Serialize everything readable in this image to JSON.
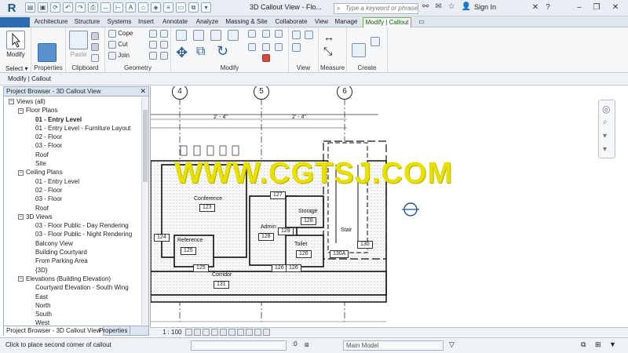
{
  "app": {
    "logo": "R",
    "window_title": "3D Callout View - Flo...",
    "search_placeholder": "Type a keyword or phrase",
    "sign_in": "Sign In"
  },
  "tabs": [
    "Architecture",
    "Structure",
    "Systems",
    "Insert",
    "Annotate",
    "Analyze",
    "Massing & Site",
    "Collaborate",
    "View",
    "Manage",
    "Modify | Callout"
  ],
  "ribbon": {
    "modify": "Modify",
    "select": "Select ▾",
    "properties": "Properties",
    "clipboard": "Clipboard",
    "paste": "Paste",
    "geometry": "Geometry",
    "cope": "Cope",
    "cut": "Cut",
    "join": "Join",
    "modify_panel": "Modify",
    "view": "View",
    "measure": "Measure",
    "create": "Create"
  },
  "options_bar": "Modify | Callout",
  "project_browser": {
    "title": "Project Browser - 3D Callout View",
    "items": [
      {
        "text": "Views (all)",
        "level": 0,
        "toggle": "−"
      },
      {
        "text": "Floor Plans",
        "level": 1,
        "toggle": "−"
      },
      {
        "text": "01 - Entry Level",
        "level": 2,
        "bold": true
      },
      {
        "text": "01 - Entry Level - Furniture Layout",
        "level": 2
      },
      {
        "text": "02 - Floor",
        "level": 2
      },
      {
        "text": "03 - Floor",
        "level": 2
      },
      {
        "text": "Roof",
        "level": 2
      },
      {
        "text": "Site",
        "level": 2
      },
      {
        "text": "Ceiling Plans",
        "level": 1,
        "toggle": "−"
      },
      {
        "text": "01 - Entry Level",
        "level": 2
      },
      {
        "text": "02 - Floor",
        "level": 2
      },
      {
        "text": "03 - Floor",
        "level": 2
      },
      {
        "text": "Roof",
        "level": 2
      },
      {
        "text": "3D Views",
        "level": 1,
        "toggle": "−"
      },
      {
        "text": "03 - Floor Public - Day Rendering",
        "level": 2
      },
      {
        "text": "03 - Floor Public - Night Rendering",
        "level": 2
      },
      {
        "text": "Balcony View",
        "level": 2
      },
      {
        "text": "Building Courtyard",
        "level": 2
      },
      {
        "text": "From Parking Area",
        "level": 2
      },
      {
        "text": "{3D}",
        "level": 2
      },
      {
        "text": "Elevations (Building Elevation)",
        "level": 1,
        "toggle": "−"
      },
      {
        "text": "Courtyard Elevation - South Wing",
        "level": 2
      },
      {
        "text": "East",
        "level": 2
      },
      {
        "text": "North",
        "level": 2
      },
      {
        "text": "South",
        "level": 2
      },
      {
        "text": "West",
        "level": 2
      }
    ],
    "tab_browser": "Project Browser - 3D Callout View",
    "tab_properties": "Properties"
  },
  "drawing": {
    "grid_labels": [
      "4",
      "5",
      "6"
    ],
    "dims": [
      "2' - 4\"",
      "2' - 4\""
    ],
    "rooms": [
      {
        "name": "Conference",
        "num": "123"
      },
      {
        "name": "Storage",
        "num": "128"
      },
      {
        "name": "Admin",
        "num": "128"
      },
      {
        "name": "Toilet",
        "num": "126"
      },
      {
        "name": "Stair",
        "num": "130"
      },
      {
        "name": "Corridor",
        "num": "131"
      },
      {
        "name": "Reference",
        "num": "125"
      }
    ],
    "tags": [
      "127",
      "129",
      "124",
      "125",
      "126",
      "126",
      "130A"
    ],
    "watermark": "WWW.CGTSJ.COM"
  },
  "view_control": {
    "scale": "1 : 100"
  },
  "status": {
    "message": "Click to place second corner of callout",
    "workset": "Main Model",
    "coords": ":0"
  }
}
